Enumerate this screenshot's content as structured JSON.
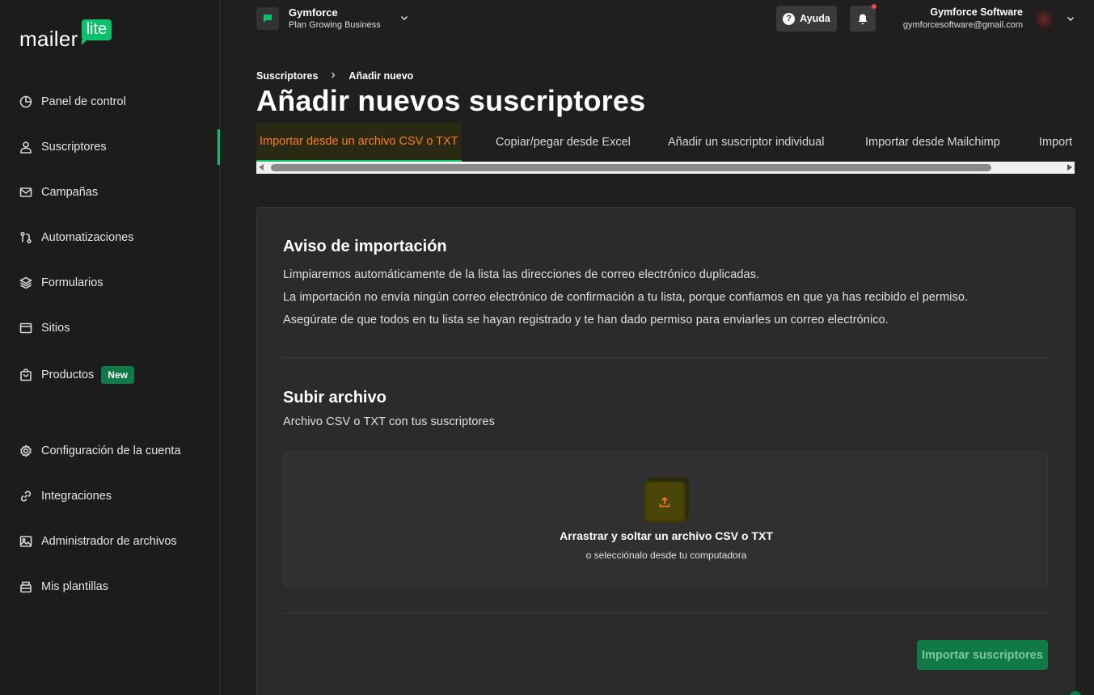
{
  "brand": {
    "logo_text": "mailer",
    "logo_bubble": "lite",
    "accent": "#09c269"
  },
  "sidebar": {
    "items": [
      {
        "label": "Panel de control",
        "icon": "dashboard-icon"
      },
      {
        "label": "Suscriptores",
        "icon": "user-icon",
        "active": true
      },
      {
        "label": "Campañas",
        "icon": "mail-icon"
      },
      {
        "label": "Automatizaciones",
        "icon": "automation-icon"
      },
      {
        "label": "Formularios",
        "icon": "layers-icon"
      },
      {
        "label": "Sitios",
        "icon": "browser-icon"
      },
      {
        "label": "Productos",
        "icon": "bag-icon",
        "badge": "New"
      },
      {
        "label": "Configuración de la cuenta",
        "icon": "gear-icon"
      },
      {
        "label": "Integraciones",
        "icon": "link-icon"
      },
      {
        "label": "Administrador de archivos",
        "icon": "image-icon"
      },
      {
        "label": "Mis plantillas",
        "icon": "template-icon"
      }
    ]
  },
  "topbar": {
    "workspace_name": "Gymforce",
    "workspace_plan": "Plan Growing Business",
    "help_label": "Ayuda",
    "account_name": "Gymforce Software",
    "account_email": "gymforcesoftware@gmail.com"
  },
  "breadcrumb": {
    "parent": "Suscriptores",
    "current": "Añadir nuevo"
  },
  "page_title": "Añadir nuevos suscriptores",
  "tabs": [
    {
      "label": "Importar desde un archivo CSV o TXT",
      "active": true
    },
    {
      "label": "Copiar/pegar desde Excel"
    },
    {
      "label": "Añadir un suscriptor individual"
    },
    {
      "label": "Importar desde Mailchimp"
    },
    {
      "label": "Import"
    }
  ],
  "notice": {
    "title": "Aviso de importación",
    "lines": [
      "Limpiaremos automáticamente de la lista las direcciones de correo electrónico duplicadas.",
      "La importación no envía ningún correo electrónico de confirmación a tu lista, porque confiamos en que ya has recibido el permiso.",
      "Asegúrate de que todos en tu lista se hayan registrado y te han dado permiso para enviarles un correo electrónico."
    ]
  },
  "upload": {
    "title": "Subir archivo",
    "subtitle": "Archivo CSV o TXT con tus suscriptores",
    "dropzone_title": "Arrastrar y soltar un archivo CSV o TXT",
    "dropzone_sub": "o selecciónalo desde tu computadora",
    "submit_label": "Importar suscriptores"
  }
}
